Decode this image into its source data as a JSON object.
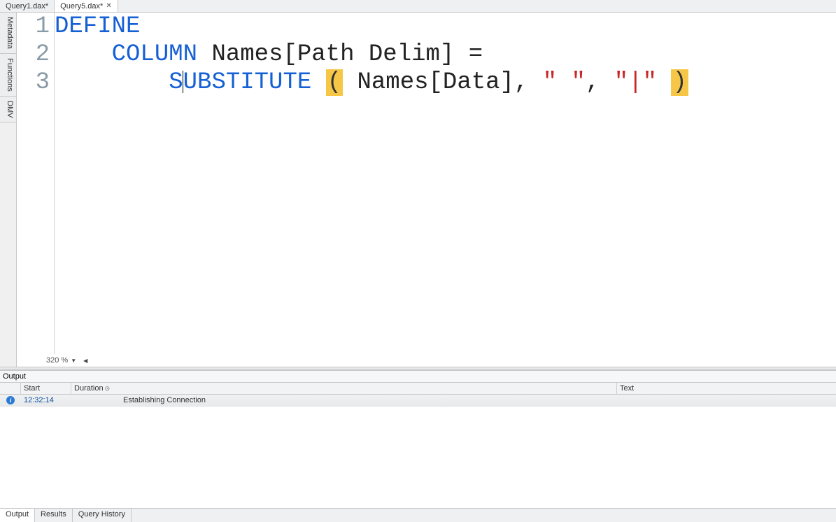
{
  "tabs": [
    {
      "label": "Query1.dax*"
    },
    {
      "label": "Query5.dax*"
    }
  ],
  "active_tab_index": 1,
  "side_tabs": [
    "Metadata",
    "Functions",
    "DMV"
  ],
  "code": {
    "lines": [
      {
        "num": "1"
      },
      {
        "num": "2"
      },
      {
        "num": "3"
      }
    ],
    "kw_define": "DEFINE",
    "kw_column": "COLUMN",
    "fn_substitute": "SUBSTITUTE",
    "ident_names_pathdelim": "Names[Path Delim]",
    "ident_names_data": "Names[Data]",
    "eq": " = ",
    "str_space": "\" \"",
    "str_pipe": "\"|\"",
    "open_paren": "(",
    "close_paren": ")",
    "comma": ","
  },
  "zoom": "320 %",
  "output": {
    "title": "Output",
    "columns": {
      "start": "Start",
      "duration": "Duration",
      "text": "Text"
    },
    "rows": [
      {
        "start": "12:32:14",
        "duration": "",
        "text": "Establishing Connection"
      }
    ]
  },
  "bottom_tabs": [
    "Output",
    "Results",
    "Query History"
  ],
  "active_bottom_tab_index": 0
}
